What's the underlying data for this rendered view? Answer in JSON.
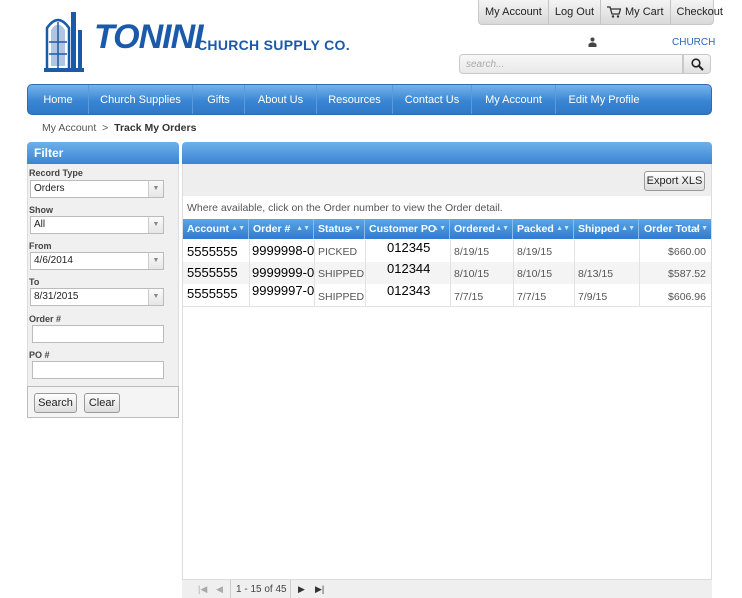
{
  "header": {
    "toplinks": [
      "My Account",
      "Log Out",
      "My Cart",
      "Checkout"
    ],
    "logo_main": "TONINI",
    "logo_sub": "CHURCH SUPPLY CO.",
    "church_link": "CHURCH",
    "search_placeholder": "search..."
  },
  "nav": [
    "Home",
    "Church Supplies",
    "Gifts",
    "About Us",
    "Resources",
    "Contact Us",
    "My Account",
    "Edit My Profile"
  ],
  "breadcrumb": {
    "parent": "My Account",
    "separator": ">",
    "current": "Track My Orders"
  },
  "filter": {
    "title": "Filter",
    "record_type_label": "Record Type",
    "record_type_value": "Orders",
    "show_label": "Show",
    "show_value": "All",
    "from_label": "From",
    "from_value": "4/6/2014",
    "to_label": "To",
    "to_value": "8/31/2015",
    "order_label": "Order #",
    "po_label": "PO #",
    "search_button": "Search",
    "clear_button": "Clear"
  },
  "grid": {
    "export_button": "Export XLS",
    "note": "Where available, click on the Order number to view the Order detail.",
    "columns": [
      "Account",
      "Order #",
      "Status",
      "Customer PO",
      "Ordered",
      "Packed",
      "Shipped",
      "Order Total"
    ],
    "rows": [
      [
        "5555555",
        "9999998-0",
        "PICKED",
        "012345",
        "8/19/15",
        "8/19/15",
        "",
        "$660.00"
      ],
      [
        "5555555",
        "9999999-0",
        "SHIPPED",
        "012344",
        "8/10/15",
        "8/10/15",
        "8/13/15",
        "$587.52"
      ],
      [
        "5555555",
        "9999997-0",
        "SHIPPED",
        "012343",
        "7/7/15",
        "7/7/15",
        "7/9/15",
        "$606.96"
      ]
    ],
    "pager_text": "1 - 15 of 45"
  },
  "colors": {
    "brand_blue": "#1a5aa8",
    "nav_blue": "#3a86d4"
  }
}
